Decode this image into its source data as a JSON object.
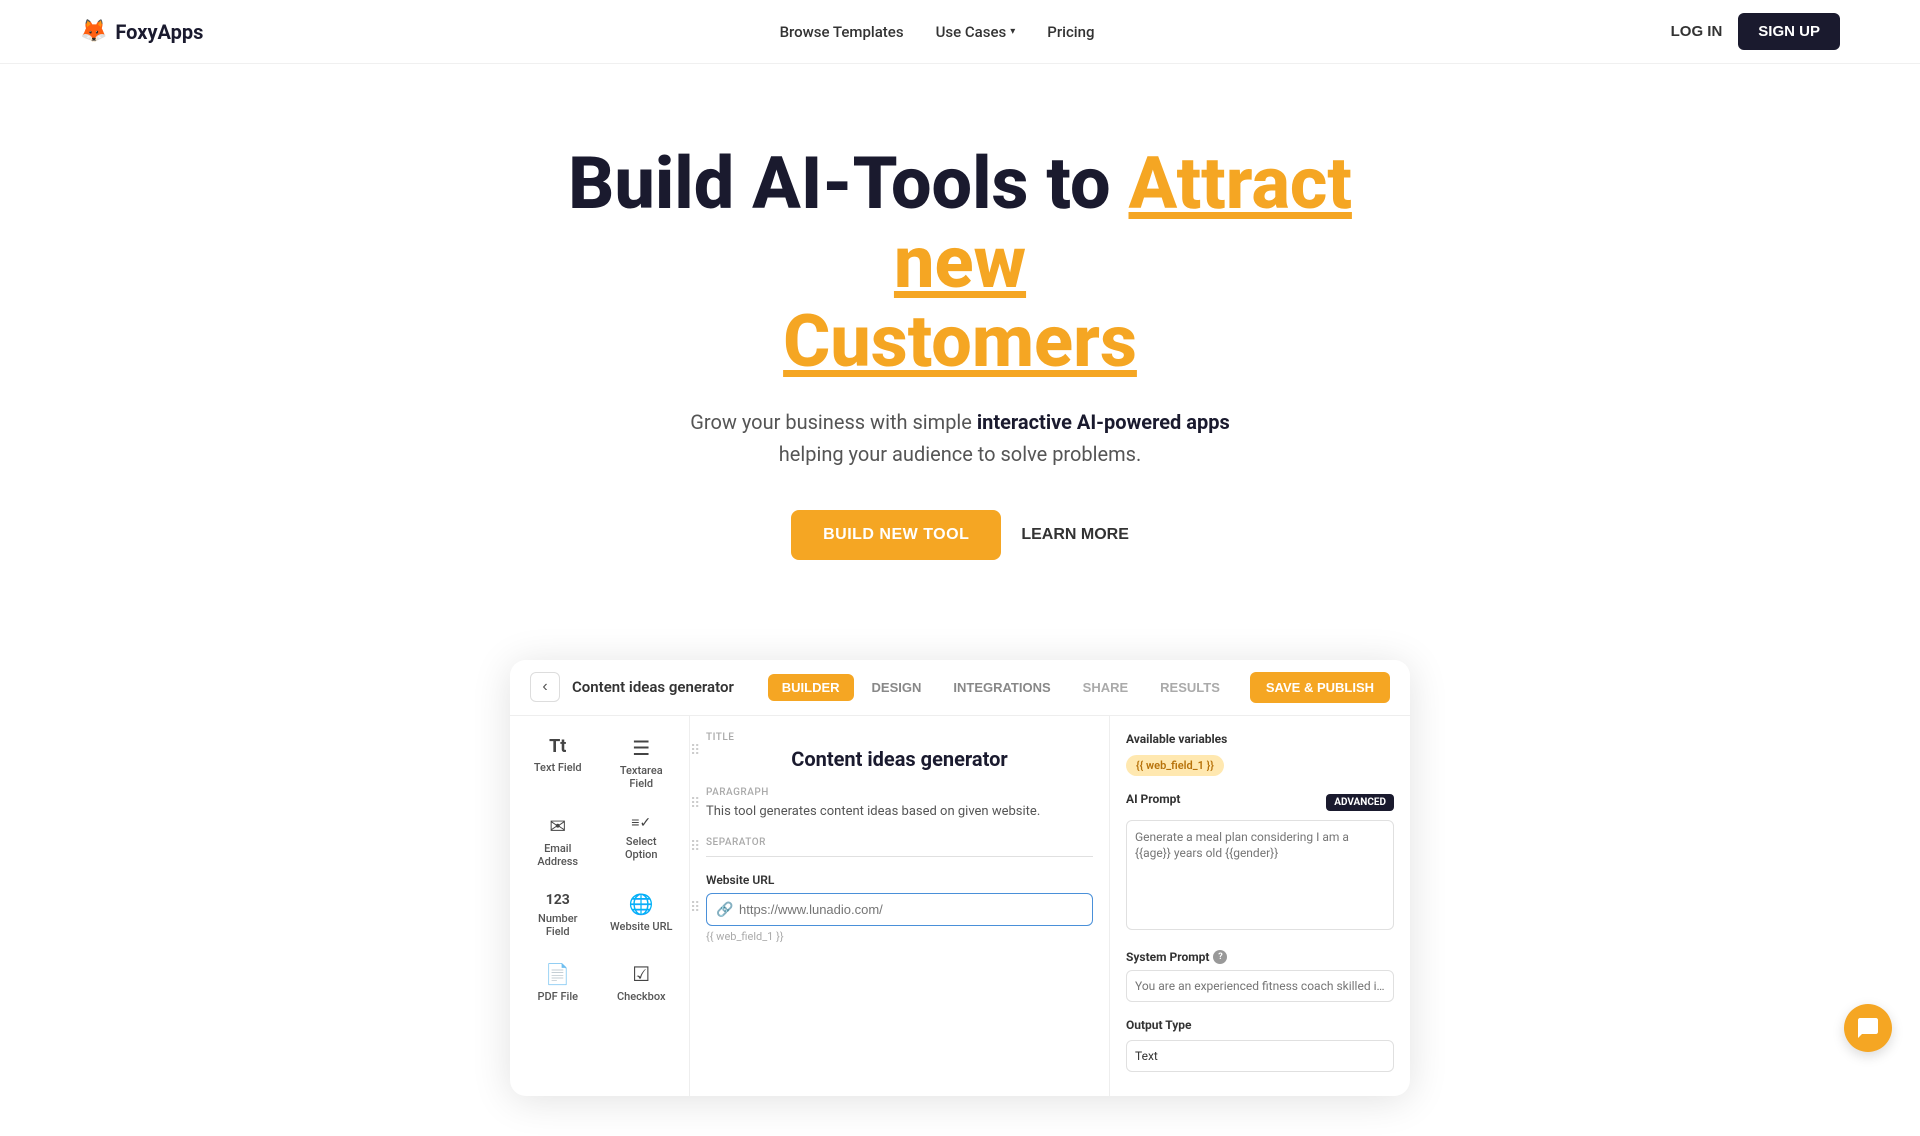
{
  "nav": {
    "logo_text": "FoxyApps",
    "logo_icon": "🦊",
    "links": [
      {
        "label": "Browse Templates",
        "id": "browse-templates",
        "has_dropdown": false
      },
      {
        "label": "Use Cases",
        "id": "use-cases",
        "has_dropdown": true
      },
      {
        "label": "Pricing",
        "id": "pricing",
        "has_dropdown": false
      }
    ],
    "login_label": "LOG IN",
    "signup_label": "SIGN UP"
  },
  "hero": {
    "line1": "Build AI-Tools to ",
    "line1_highlight": "Attract new",
    "line2": "Customers",
    "subtitle_normal": "Grow your business with simple ",
    "subtitle_bold": "interactive AI-powered apps",
    "subtitle_end": "helping your audience to solve problems.",
    "cta_primary": "BUILD NEW TOOL",
    "cta_secondary": "LEARN MORE"
  },
  "demo": {
    "back_icon": "‹",
    "tool_title": "Content ideas generator",
    "tabs": [
      {
        "label": "BUILDER",
        "active": true
      },
      {
        "label": "DESIGN",
        "active": false
      },
      {
        "label": "INTEGRATIONS",
        "active": false
      },
      {
        "label": "SHARE",
        "active": false,
        "disabled": true
      },
      {
        "label": "RESULTS",
        "active": false,
        "disabled": true
      }
    ],
    "save_button": "SAVE & PUBLISH",
    "left_fields": [
      {
        "icon": "Tt",
        "label": "Text Field"
      },
      {
        "icon": "≡",
        "label": "Textarea Field"
      },
      {
        "icon": "✉",
        "label": "Email Address"
      },
      {
        "icon": "≡✓",
        "label": "Select Option"
      },
      {
        "icon": "123",
        "label": "Number Field"
      },
      {
        "icon": "🌐",
        "label": "Website URL"
      },
      {
        "icon": "📄",
        "label": "PDF File"
      },
      {
        "icon": "☑",
        "label": "Checkbox"
      }
    ],
    "center": {
      "title_block": {
        "label": "Title",
        "content": "Content ideas generator"
      },
      "paragraph_block": {
        "label": "Paragraph",
        "content": "This tool generates content ideas based on given website."
      },
      "separator_label": "Separator",
      "website_url_block": {
        "label": "Website URL",
        "placeholder": "https://www.lunadio.com/",
        "variable": "{{ web_field_1 }}"
      }
    },
    "right": {
      "available_variables_label": "Available variables",
      "variable_badge": "{{ web_field_1 }}",
      "ai_prompt_label": "AI Prompt",
      "advanced_badge": "ADVANCED",
      "ai_prompt_placeholder": "Generate a meal plan considering I am a {{age}} years old {{gender}}",
      "system_prompt_label": "System Prompt",
      "system_prompt_info": "?",
      "system_prompt_placeholder": "You are an experienced fitness coach skilled in meal plann",
      "output_type_label": "Output Type",
      "output_type_value": "Text"
    }
  }
}
